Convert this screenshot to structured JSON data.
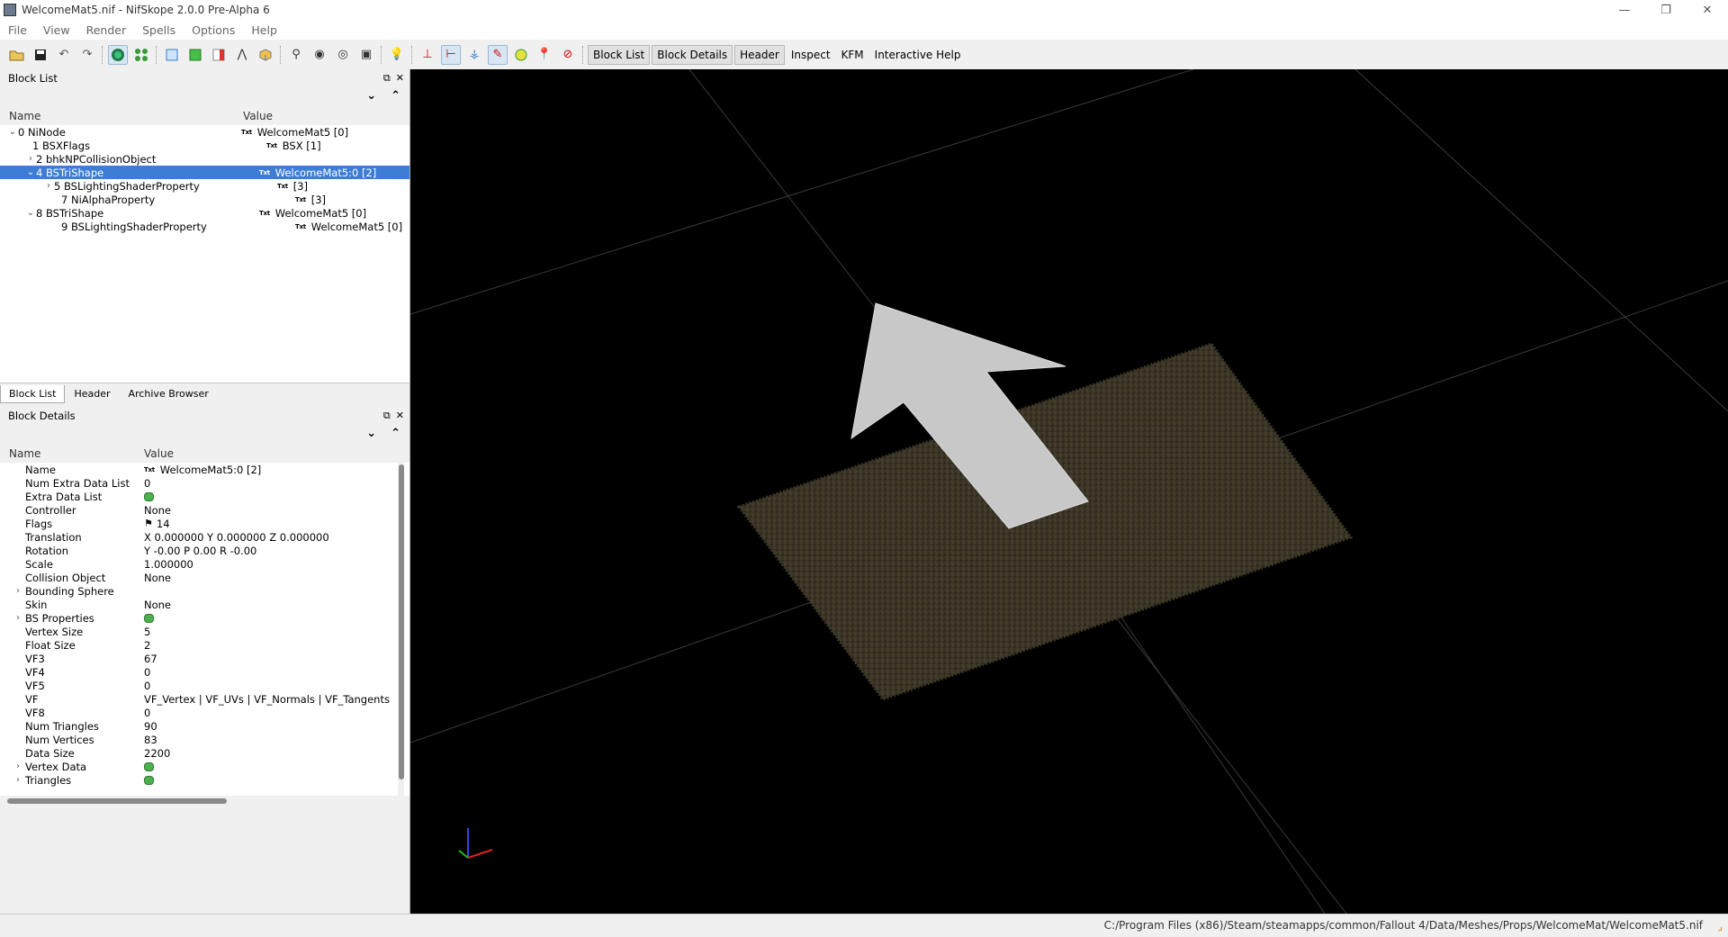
{
  "window": {
    "title": "WelcomeMat5.nif - NifSkope 2.0.0 Pre-Alpha 6",
    "controls": [
      "—",
      "❐",
      "✕"
    ]
  },
  "menu": [
    "File",
    "View",
    "Render",
    "Spells",
    "Options",
    "Help"
  ],
  "toolbar": {
    "text_buttons": [
      "Block List",
      "Block Details",
      "Header",
      "Inspect",
      "KFM",
      "Interactive Help"
    ]
  },
  "block_list": {
    "title": "Block List",
    "col_name": "Name",
    "col_value": "Value",
    "txt_tag": "Txt",
    "rows": [
      {
        "name": "0 NiNode",
        "value": "WelcomeMat5 [0]"
      },
      {
        "name": "1 BSXFlags",
        "value": "BSX [1]"
      },
      {
        "name": "2 bhkNPCollisionObject",
        "value": ""
      },
      {
        "name": "4 BSTriShape",
        "value": "WelcomeMat5:0 [2]"
      },
      {
        "name": "5 BSLightingShaderProperty",
        "value": "[3]"
      },
      {
        "name": "7 NiAlphaProperty",
        "value": "[3]"
      },
      {
        "name": "8 BSTriShape",
        "value": "WelcomeMat5 [0]"
      },
      {
        "name": "9 BSLightingShaderProperty",
        "value": "WelcomeMat5 [0]"
      }
    ],
    "tabs": [
      "Block List",
      "Header",
      "Archive Browser"
    ]
  },
  "block_details": {
    "title": "Block Details",
    "col_name": "Name",
    "col_value": "Value",
    "txt_tag": "Txt",
    "rows": [
      {
        "name": "Name",
        "value": "WelcomeMat5:0 [2]"
      },
      {
        "name": "Num Extra Data List",
        "value": "0"
      },
      {
        "name": "Extra Data List",
        "value": ""
      },
      {
        "name": "Controller",
        "value": "None"
      },
      {
        "name": "Flags",
        "value": "14"
      },
      {
        "name": "Translation",
        "value": "X 0.000000 Y 0.000000 Z 0.000000"
      },
      {
        "name": "Rotation",
        "value": "Y -0.00 P 0.00 R -0.00"
      },
      {
        "name": "Scale",
        "value": "1.000000"
      },
      {
        "name": "Collision Object",
        "value": "None"
      },
      {
        "name": "Bounding Sphere",
        "value": ""
      },
      {
        "name": "Skin",
        "value": "None"
      },
      {
        "name": "BS Properties",
        "value": ""
      },
      {
        "name": "Vertex Size",
        "value": "5"
      },
      {
        "name": "Float Size",
        "value": "2"
      },
      {
        "name": "VF3",
        "value": "67"
      },
      {
        "name": "VF4",
        "value": "0"
      },
      {
        "name": "VF5",
        "value": "0"
      },
      {
        "name": "VF",
        "value": "VF_Vertex | VF_UVs | VF_Normals | VF_Tangents"
      },
      {
        "name": "VF8",
        "value": "0"
      },
      {
        "name": "Num Triangles",
        "value": "90"
      },
      {
        "name": "Num Vertices",
        "value": "83"
      },
      {
        "name": "Data Size",
        "value": "2200"
      },
      {
        "name": "Vertex Data",
        "value": ""
      },
      {
        "name": "Triangles",
        "value": ""
      }
    ]
  },
  "status": {
    "path": "C:/Program Files (x86)/Steam/steamapps/common/Fallout 4/Data/Meshes/Props/WelcomeMat/WelcomeMat5.nif"
  }
}
